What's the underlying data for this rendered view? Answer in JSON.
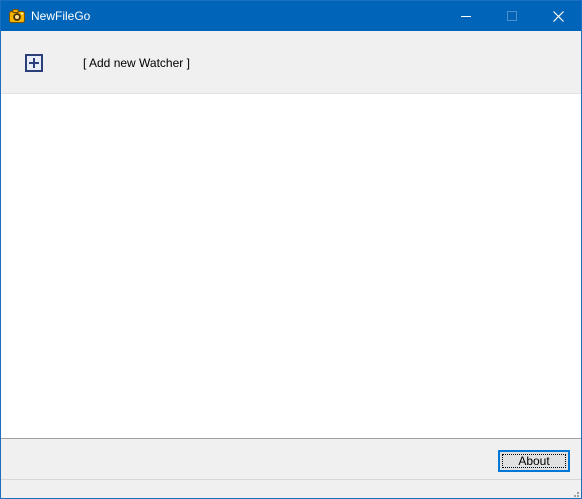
{
  "window": {
    "title": "NewFileGo",
    "app_icon": "camera-app-icon",
    "controls": {
      "minimize_icon": "minimize-icon",
      "maximize_icon": "maximize-icon",
      "close_icon": "close-icon"
    }
  },
  "toolbar": {
    "add_icon": "plus-box-icon",
    "add_label": "[ Add new Watcher ]"
  },
  "watchers": [],
  "footer": {
    "about_label": "About"
  },
  "statusbar": {
    "grip_icon": "size-grip-icon"
  },
  "colors": {
    "titlebar": "#0064b8",
    "panel": "#f0f0f0",
    "accent": "#0078d7"
  }
}
